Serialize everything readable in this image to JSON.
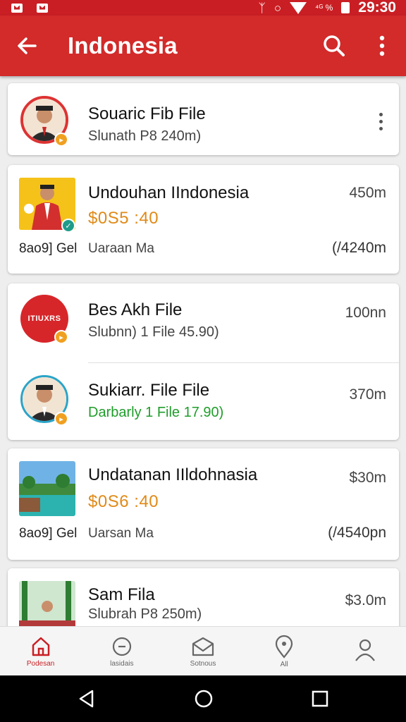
{
  "status_bar": {
    "signal_text": "ᛉ",
    "data_text": "⁴ᴳ %",
    "time": "29:30"
  },
  "app_bar": {
    "title": "Indonesia",
    "back_icon": "arrow-left-icon",
    "search_icon": "search-icon",
    "menu_icon": "more-vert-icon"
  },
  "items": [
    {
      "title": "Souaric Fib File",
      "subtitle": "Slunath P8 240m)"
    },
    {
      "title": "Undouhan IIndonesia",
      "price": "$0S5 :40",
      "right": "450m",
      "foot_left": "8ao9] Gel",
      "foot_mid": "Uaraan Ma",
      "foot_right": "(/4240m"
    },
    {
      "title": "Bes Akh File",
      "subtitle": "Slubnn) 1 File 45.90)",
      "right": "100nn",
      "logo_text": "ITIUXRS"
    },
    {
      "title": "Sukiarr. File File",
      "subtitle": "Darbarly 1 File  17.90)",
      "right": "370m"
    },
    {
      "title": "Undatanan IIldohnasia",
      "price": "$0S6 :40",
      "right": "$30m",
      "foot_left": "8ao9] Gel",
      "foot_mid": "Uarsan Ma",
      "foot_right": "(/4540pn"
    },
    {
      "title": "Sam Fila",
      "subtitle": "Slubrah P8 250m)",
      "right": "$3.0m"
    }
  ],
  "bottom_nav": [
    {
      "label": "Podesan",
      "icon": "home-icon",
      "active": true
    },
    {
      "label": "lasidais",
      "icon": "smile-icon",
      "active": false
    },
    {
      "label": "Sotnous",
      "icon": "mail-icon",
      "active": false
    },
    {
      "label": "All",
      "icon": "pin-icon",
      "active": false
    },
    {
      "label": "",
      "icon": "person-icon",
      "active": false
    }
  ],
  "colors": {
    "brand": "#d32a2a",
    "price": "#e08a18",
    "green": "#1f9d2a"
  }
}
